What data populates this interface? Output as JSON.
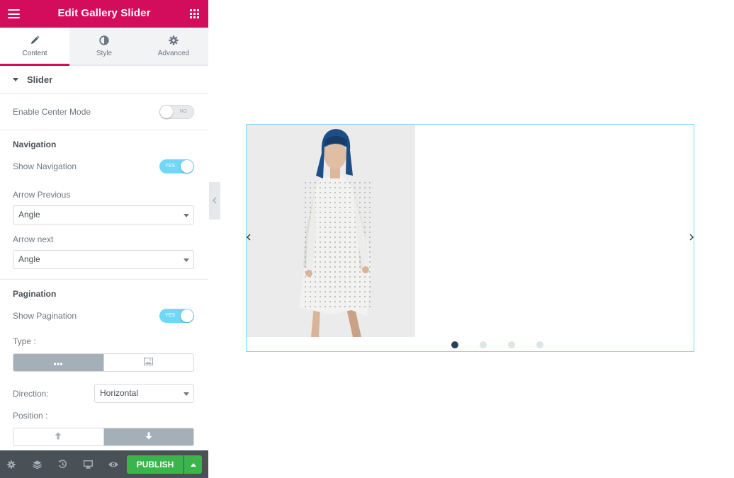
{
  "header": {
    "title": "Edit Gallery Slider",
    "menu_icon": "hamburger-icon",
    "widgets_icon": "grid-icon",
    "brand_color": "#d30c5c"
  },
  "tabs": [
    {
      "label": "Content",
      "icon": "pencil-icon",
      "active": true
    },
    {
      "label": "Style",
      "icon": "contrast-icon",
      "active": false
    },
    {
      "label": "Advanced",
      "icon": "gear-icon",
      "active": false
    }
  ],
  "section": {
    "title": "Slider",
    "expanded": true
  },
  "controls": {
    "center_mode": {
      "label": "Enable Center Mode",
      "state": "NO",
      "on": false
    },
    "navigation": {
      "heading": "Navigation",
      "show": {
        "label": "Show Navigation",
        "state": "YES",
        "on": true
      },
      "arrow_prev": {
        "label": "Arrow Previous",
        "value": "Angle"
      },
      "arrow_next": {
        "label": "Arrow next",
        "value": "Angle"
      }
    },
    "pagination": {
      "heading": "Pagination",
      "show": {
        "label": "Show Pagination",
        "state": "YES",
        "on": true
      },
      "type": {
        "label": "Type :",
        "options": [
          "dots-icon",
          "image-icon"
        ],
        "selected": 0
      },
      "direction": {
        "label": "Direction:",
        "value": "Horizontal"
      },
      "position": {
        "label": "Position :",
        "options": [
          "arrow-up-icon",
          "arrow-down-icon"
        ],
        "selected": 1
      }
    }
  },
  "footer": {
    "icons": [
      "settings-icon",
      "layers-icon",
      "history-icon",
      "responsive-icon",
      "preview-icon"
    ],
    "publish_label": "PUBLISH",
    "publish_color": "#39b54a"
  },
  "preview": {
    "border_color": "#71d7f7",
    "dots_count": 4,
    "active_dot": 0,
    "active_dot_color": "#2c3e5c"
  }
}
